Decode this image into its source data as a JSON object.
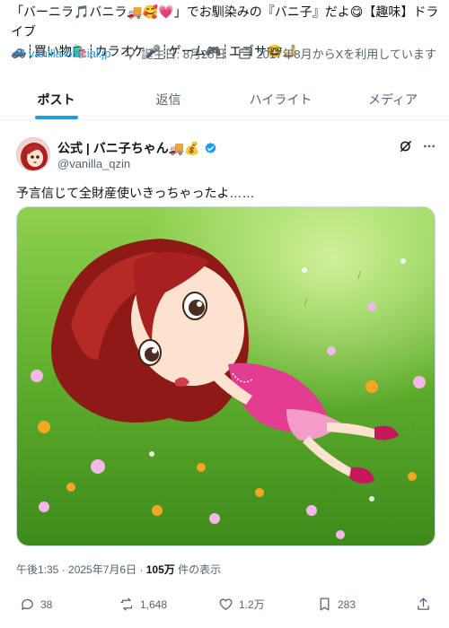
{
  "profile": {
    "bio_line1": "「バーニラ🎵バニラ🚚🥰💗」でお馴染みの『バニ子』だよ😋【趣味】ドライブ",
    "bio_line2": "🚙┊買い物🛍️┊カラオケ🎤┊ゲーム🎮┊エゴサ🤓🤳",
    "website": "vanilla-official.jp",
    "birthday": "誕生日: 8月25日",
    "joined": "2017年8月からXを利用しています"
  },
  "tabs": [
    {
      "label": "ポスト",
      "active": true
    },
    {
      "label": "返信",
      "active": false
    },
    {
      "label": "ハイライト",
      "active": false
    },
    {
      "label": "メディア",
      "active": false
    }
  ],
  "post": {
    "display_name": "公式 | バニ子ちゃん🚚💰",
    "handle": "@vanilla_qzin",
    "text": "予言信じて全財産使いきっちゃったよ……",
    "time": "午後1:35 · 2025年7月6日 · ",
    "views_count": "105万",
    "views_label": " 件の表示",
    "replies": "38",
    "reposts": "1,648",
    "likes": "1.2万",
    "bookmarks": "283"
  },
  "icons": {
    "link": "link-icon",
    "birthday": "balloon-icon",
    "calendar": "calendar-icon",
    "verified": "verified-badge-icon",
    "grok": "grok-icon",
    "more": "more-icon",
    "reply": "reply-icon",
    "repost": "repost-icon",
    "like": "heart-icon",
    "bookmark": "bookmark-icon",
    "share": "share-icon"
  },
  "colors": {
    "accent": "#1d9bf0",
    "text": "#0f1419",
    "secondary": "#536471",
    "grass": "#5fae2c"
  }
}
